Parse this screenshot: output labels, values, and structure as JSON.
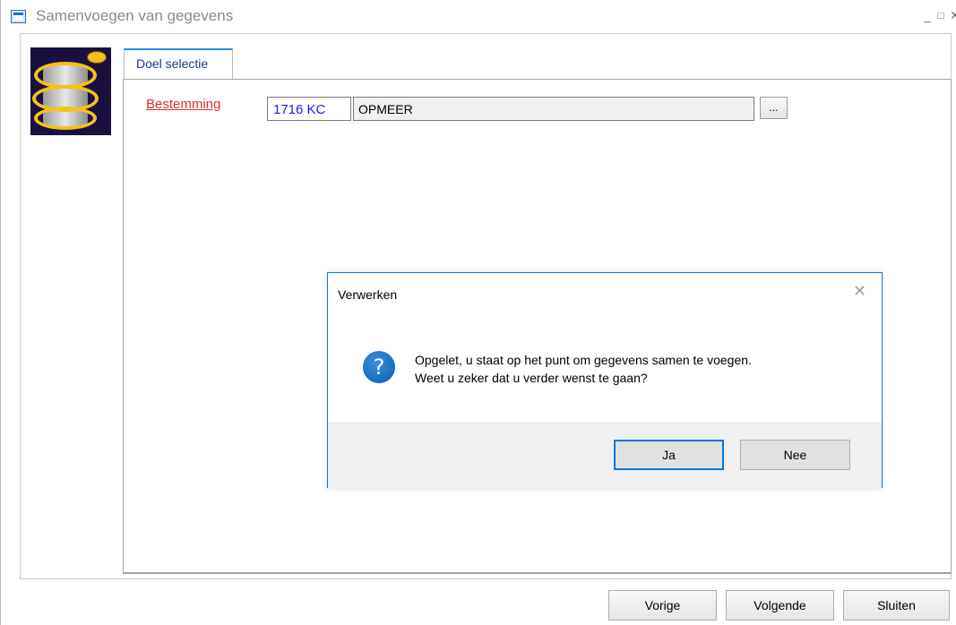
{
  "window": {
    "title": "Samenvoegen van gegevens",
    "min_glyph": "_",
    "max_glyph": "□",
    "close_glyph": "✕"
  },
  "tabs": [
    {
      "label": "Doel selectie",
      "active": true
    }
  ],
  "form": {
    "destination_label": "Bestemming",
    "postal_code": "1716 KC",
    "city": "OPMEER",
    "browse_label": "..."
  },
  "footer_buttons": {
    "previous": "Vorige",
    "next": "Volgende",
    "close": "Sluiten"
  },
  "dialog": {
    "title": "Verwerken",
    "close_glyph": "✕",
    "icon": "question-icon",
    "icon_glyph": "?",
    "message_line1": "Opgelet, u staat op het punt om gegevens samen te voegen.",
    "message_line2": "Weet u zeker dat u verder wenst te gaan?",
    "yes_label": "Ja",
    "no_label": "Nee"
  },
  "colors": {
    "accent": "#1d8ce0",
    "link_red": "#e03030",
    "postal_blue": "#1a1aff",
    "dialog_border": "#1979ca"
  }
}
